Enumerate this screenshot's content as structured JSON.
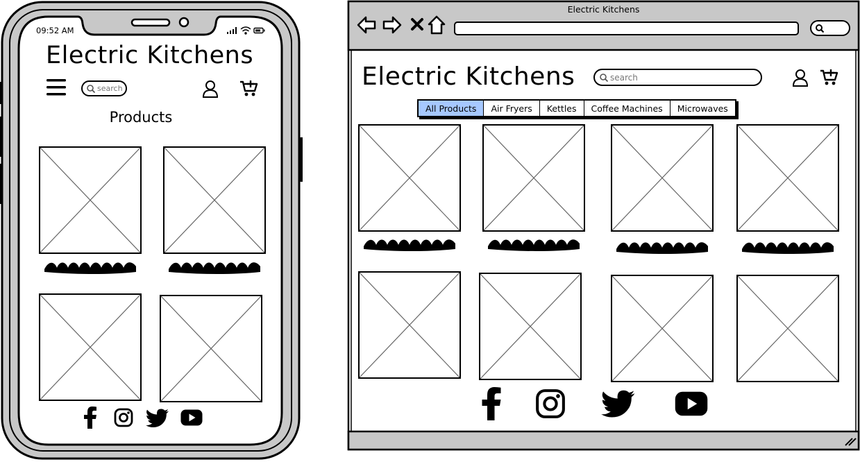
{
  "phone": {
    "status_time": "09:52 AM",
    "title": "Electric Kitchens",
    "search_placeholder": "search",
    "section_heading": "Products",
    "social_icons": [
      "facebook-icon",
      "instagram-icon",
      "twitter-icon",
      "youtube-icon"
    ]
  },
  "browser": {
    "window_title": "Electric Kitchens",
    "page_title": "Electric Kitchens",
    "search_placeholder": "search",
    "tabs": [
      {
        "label": "All Products",
        "selected": true
      },
      {
        "label": "Air Fryers",
        "selected": false
      },
      {
        "label": "Kettles",
        "selected": false
      },
      {
        "label": "Coffee Machines",
        "selected": false
      },
      {
        "label": "Microwaves",
        "selected": false
      }
    ],
    "social_icons": [
      "facebook-icon",
      "instagram-icon",
      "twitter-icon",
      "youtube-icon"
    ]
  },
  "colors": {
    "selected_tab": "#a6c8ff",
    "frame_gray": "#c8c8c8",
    "outline": "#000000"
  }
}
